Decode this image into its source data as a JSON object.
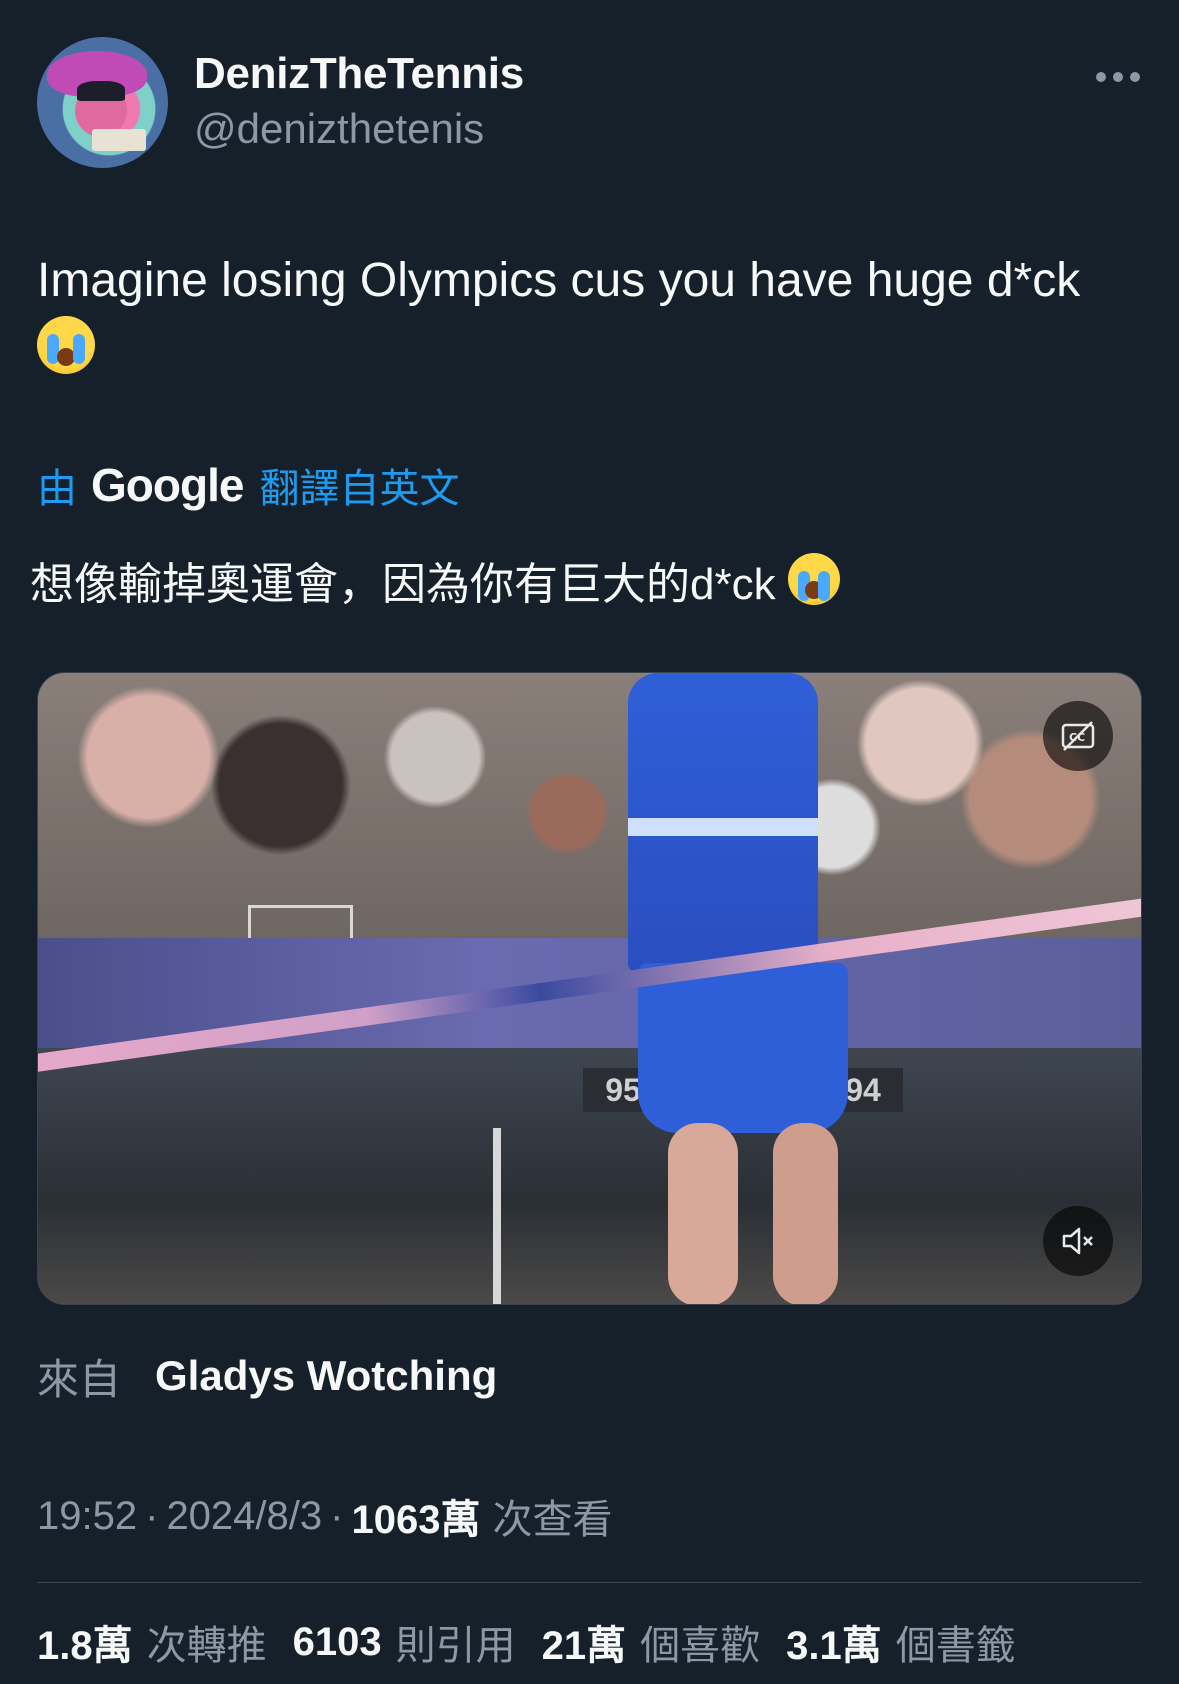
{
  "author": {
    "display_name": "DenizTheTennis",
    "handle": "@denizthetenis"
  },
  "tweet": {
    "text": "Imagine losing Olympics cus you have huge d*ck",
    "emoji": "loudly-crying-face"
  },
  "translation": {
    "by_label": "由",
    "provider": "Google",
    "from_label": "翻譯自英文",
    "text": "想像輸掉奧運會，因為你有巨大的d*ck"
  },
  "media": {
    "sign_left": "95",
    "sign_right": "94",
    "captions_icon": "captions-off-icon",
    "mute_icon": "volume-muted-icon"
  },
  "source": {
    "prefix": "來自",
    "name": "Gladys Wotching"
  },
  "meta": {
    "time": "19:52",
    "date": "2024/8/3",
    "views_count": "1063萬",
    "views_label": "次查看"
  },
  "stats": [
    {
      "count": "1.8萬",
      "label": "次轉推"
    },
    {
      "count": "6103",
      "label": "則引用"
    },
    {
      "count": "21萬",
      "label": "個喜歡"
    },
    {
      "count": "3.1萬",
      "label": "個書籤"
    }
  ],
  "colors": {
    "background": "#15202b",
    "link_blue": "#1d9bf0",
    "muted_text": "#8b98a5",
    "primary_text": "#f7f9f9"
  }
}
